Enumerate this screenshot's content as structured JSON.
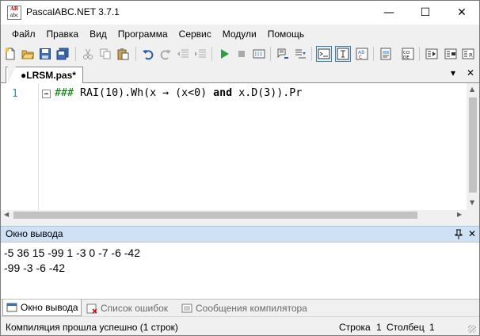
{
  "window": {
    "title": "PascalABC.NET 3.7.1",
    "app_icon_text_top": "AB",
    "app_icon_text_bottom": "abc",
    "minimize_glyph": "—",
    "maximize_glyph": "☐",
    "close_glyph": "✕"
  },
  "menu": {
    "items": [
      "Файл",
      "Правка",
      "Вид",
      "Программа",
      "Сервис",
      "Модули",
      "Помощь"
    ]
  },
  "toolbar": {
    "buttons": [
      "new-file-icon",
      "open-folder-icon",
      "save-icon",
      "save-all-icon",
      "cut-icon",
      "copy-icon",
      "paste-icon",
      "undo-icon",
      "redo-icon",
      "unindent-icon",
      "indent-icon",
      "run-icon",
      "stop-icon",
      "compile-icon",
      "step-over-icon",
      "step-into-icon",
      "output-window-toggle-icon",
      "text-toggle-icon",
      "abc-toggle-icon",
      "form-designer-icon",
      "code-icon",
      "step-template-1-icon",
      "step-template-2-icon",
      "step-template-3-icon"
    ],
    "accent_color": "#3c7fb1"
  },
  "editor": {
    "tab_label": "●LRSM.pas*",
    "tab_dropdown_glyph": "▾",
    "tab_close_glyph": "✕",
    "line_number": "1",
    "code": {
      "hash": "###",
      "part1": " RAI(10).Wh(x → (x<0) ",
      "kw": "and",
      "part2": " x.D(3)).Pr"
    }
  },
  "output": {
    "title": "Окно вывода",
    "pin_glyph": "📌",
    "close_glyph": "✕",
    "lines": [
      "-5 36 15 -99 1 -3 0 -7 -6 -42",
      "-99 -3 -6 -42"
    ]
  },
  "bottom_tabs": [
    {
      "label": "Окно вывода",
      "icon": "output-window-icon",
      "active": true
    },
    {
      "label": "Список ошибок",
      "icon": "error-list-icon",
      "active": false
    },
    {
      "label": "Сообщения компилятора",
      "icon": "compiler-messages-icon",
      "active": false
    }
  ],
  "status": {
    "message": "Компиляция прошла успешно (1 строк)",
    "row_label": "Строка",
    "row_value": "1",
    "col_label": "Столбец",
    "col_value": "1"
  }
}
